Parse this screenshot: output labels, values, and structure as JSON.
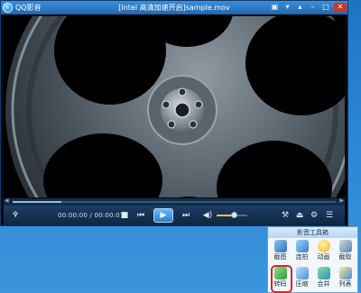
{
  "app": {
    "name": "QQ影音"
  },
  "window": {
    "title": "[Intel 高清加速开启]sample.mov"
  },
  "controls": {
    "time": "00:00:00 / 00:00:07",
    "seek_progress": 0.15,
    "volume_level": 0.55
  },
  "tools_panel": {
    "title": "影音工具箱",
    "items": [
      {
        "label": "截图",
        "icon": "screenshot-icon"
      },
      {
        "label": "连拍",
        "icon": "burst-icon"
      },
      {
        "label": "动画",
        "icon": "animation-icon"
      },
      {
        "label": "截取",
        "icon": "clip-icon"
      },
      {
        "label": "转码",
        "icon": "transcode-icon"
      },
      {
        "label": "压缩",
        "icon": "compress-icon"
      },
      {
        "label": "合并",
        "icon": "merge-icon"
      },
      {
        "label": "列表",
        "icon": "list-icon"
      }
    ]
  },
  "colors": {
    "highlight": "#d8272b",
    "accent": "#2a7fd1"
  }
}
